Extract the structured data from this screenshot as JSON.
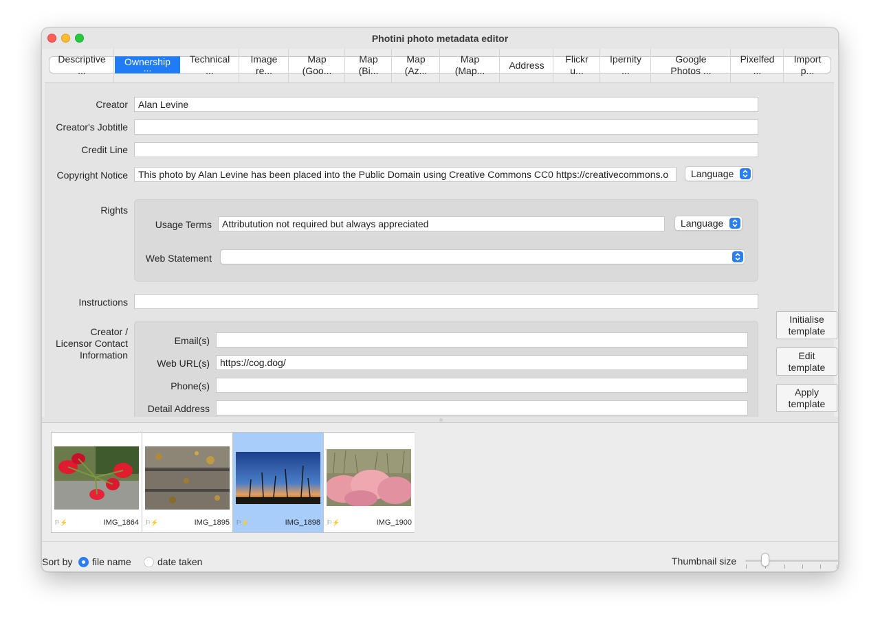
{
  "window": {
    "title": "Photini photo metadata editor"
  },
  "tabs": [
    {
      "label": "Descriptive",
      "sub": "..."
    },
    {
      "label": "Ownership",
      "sub": "..."
    },
    {
      "label": "Technical",
      "sub": "..."
    },
    {
      "label": "Image",
      "sub": "re..."
    },
    {
      "label": "Map",
      "sub": "(Goo..."
    },
    {
      "label": "Map",
      "sub": "(Bi..."
    },
    {
      "label": "Map",
      "sub": "(Az..."
    },
    {
      "label": "Map",
      "sub": "(Map..."
    },
    {
      "label": "Address",
      "sub": ""
    },
    {
      "label": "Flickr",
      "sub": "u..."
    },
    {
      "label": "Ipernity",
      "sub": "..."
    },
    {
      "label": "Google",
      "sub": "Photos ..."
    },
    {
      "label": "Pixelfed",
      "sub": "..."
    },
    {
      "label": "Import",
      "sub": "p..."
    }
  ],
  "form": {
    "creator_label": "Creator",
    "creator_value": "Alan Levine",
    "jobtitle_label": "Creator's Jobtitle",
    "jobtitle_value": "",
    "credit_label": "Credit Line",
    "credit_value": "",
    "copyright_label": "Copyright Notice",
    "copyright_value": "This photo by Alan Levine has been placed into the Public Domain using Creative Commons CC0 https://creativecommons.o",
    "copyright_language": "Language",
    "rights_label": "Rights",
    "usage_label": "Usage Terms",
    "usage_value": "Attributution not required but always appreciated",
    "usage_language": "Language",
    "web_statement_label": "Web Statement",
    "web_statement_value": "",
    "instructions_label": "Instructions",
    "instructions_value": "",
    "contact_label_1": "Creator /",
    "contact_label_2": "Licensor Contact",
    "contact_label_3": "Information",
    "email_label": "Email(s)",
    "email_value": "",
    "url_label": "Web URL(s)",
    "url_value": "https://cog.dog/",
    "phone_label": "Phone(s)",
    "phone_value": "",
    "address_label": "Detail Address",
    "address_value": ""
  },
  "template_buttons": {
    "initialise_1": "Initialise",
    "initialise_2": "template",
    "edit_1": "Edit",
    "edit_2": "template",
    "apply_1": "Apply",
    "apply_2": "template"
  },
  "thumbnails": [
    {
      "name": "IMG_1864",
      "flags": "⚐⚡",
      "selected": false
    },
    {
      "name": "IMG_1895",
      "flags": "⚐⚡",
      "selected": false
    },
    {
      "name": "IMG_1898",
      "flags": "⚐⚡",
      "selected": true
    },
    {
      "name": "IMG_1900",
      "flags": "⚐⚡",
      "selected": false
    }
  ],
  "bottom": {
    "sort_label": "Sort by",
    "sort_file_name": "file name",
    "sort_date_taken": "date taken",
    "sort_selected": "file name",
    "thumb_size_label": "Thumbnail size"
  },
  "colors": {
    "accent": "#1f7cf5",
    "selection": "#a8cdfa"
  }
}
